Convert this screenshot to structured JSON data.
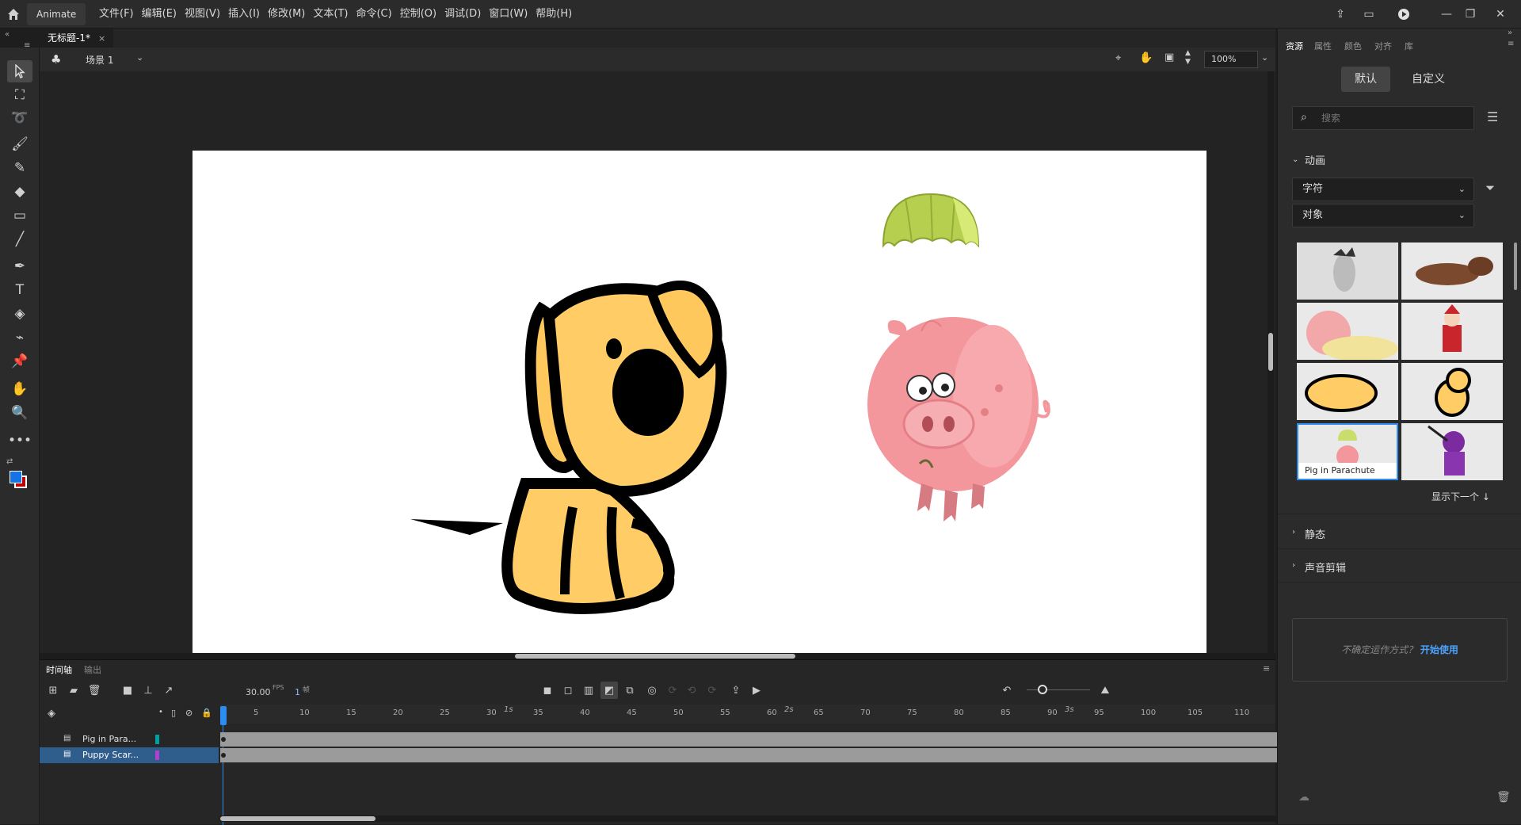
{
  "app": {
    "name": "Animate",
    "menus": [
      "文件(F)",
      "编辑(E)",
      "视图(V)",
      "插入(I)",
      "修改(M)",
      "文本(T)",
      "命令(C)",
      "控制(O)",
      "调试(D)",
      "窗口(W)",
      "帮助(H)"
    ]
  },
  "document": {
    "tab_title": "无标题-1*",
    "close": "×"
  },
  "scene": {
    "name": "场景 1",
    "zoom": "100%"
  },
  "timeline": {
    "tabs": [
      "时间轴",
      "输出"
    ],
    "fps": "30.00",
    "fps_unit": "FPS",
    "frame": "1",
    "frame_unit": "帧",
    "ruler_seconds": [
      "1s",
      "2s",
      "3s"
    ],
    "ruler_frames": [
      "5",
      "10",
      "15",
      "20",
      "25",
      "30",
      "35",
      "40",
      "45",
      "50",
      "55",
      "60",
      "65",
      "70",
      "75",
      "80",
      "85",
      "90",
      "95",
      "100",
      "105",
      "110"
    ],
    "layers": [
      {
        "name": "Pig in Para...",
        "color": "#00a0a0"
      },
      {
        "name": "Puppy Scar...",
        "color": "#b040d0"
      }
    ]
  },
  "panel": {
    "tabs": [
      "资源",
      "属性",
      "颜色",
      "对齐",
      "库"
    ],
    "segments": [
      "默认",
      "自定义"
    ],
    "search_placeholder": "搜索",
    "section_animation": "动画",
    "dropdown1": "字符",
    "dropdown2": "对象",
    "selected_thumb_label": "Pig in Parachute",
    "show_next": "显示下一个",
    "section_static": "静态",
    "section_sound": "声音剪辑",
    "help_text": "不确定运作方式？",
    "help_link": "开始使用"
  },
  "colors": {
    "accent": "#2d8cf0",
    "stroke_swatch": "#ffffff",
    "fill_swatch": "#1473e6"
  }
}
